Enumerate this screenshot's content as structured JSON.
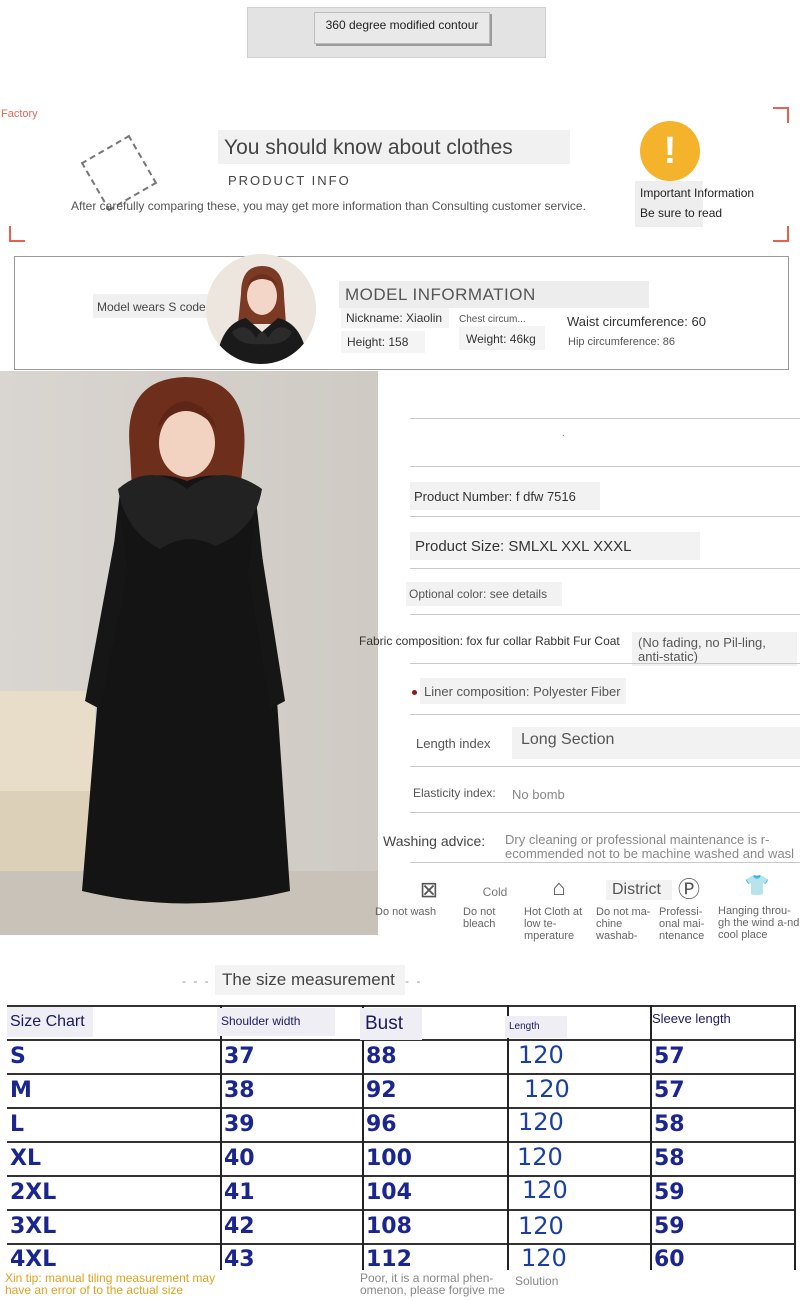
{
  "banner": {
    "button_label": "360 degree modified contour"
  },
  "know": {
    "factory": "Factory",
    "title": "You should know about clothes",
    "subtitle": "PRODUCT INFO",
    "note": "After carefully comparing these, you may get more information than Consulting customer service.",
    "important": "Important Information",
    "be_sure": "Be sure to read",
    "warn_symbol": "!"
  },
  "model": {
    "wears": "Model wears S code",
    "title": "MODEL INFORMATION",
    "nickname": "Nickname: Xiaolin",
    "chest": "Chest circum...",
    "waist": "Waist circumference: 60",
    "height": "Height: 158",
    "weight": "Weight: 46kg",
    "hip": "Hip circumference: 86"
  },
  "specs": {
    "dot": ".",
    "product_number": "Product Number: f dfw 7516",
    "product_size": "Product Size: SMLXL XXL XXXL",
    "optional_color": "Optional color: see details",
    "fabric": "Fabric composition: fox fur collar Rabbit Fur Coat",
    "fabric_note": "(No fading, no Pil-ling, anti-static)",
    "liner": "Liner composition: Polyester Fiber",
    "length_label": "Length index",
    "length_value": "Long Section",
    "elasticity_label": "Elasticity index:",
    "elasticity_value": "No bomb",
    "washing_label": "Washing advice:",
    "washing_value": "Dry cleaning or professional maintenance is r-ecommended not to be machine washed and wasl"
  },
  "care": [
    {
      "icon": "no-wash-icon",
      "glyph": "⊠",
      "text": "Do not wash"
    },
    {
      "icon": "no-bleach-icon",
      "glyph": "Cold",
      "text": "Do not bleach"
    },
    {
      "icon": "iron-icon",
      "glyph": "⌂",
      "text": "Hot Cloth at low te-mperature"
    },
    {
      "icon": "no-machine-wash-icon",
      "glyph": "District",
      "text": "Do not ma-chine washab-"
    },
    {
      "icon": "professional-care-icon",
      "glyph": "Ⓟ",
      "text": "Professi-onal mai-ntenance"
    },
    {
      "icon": "hang-dry-icon",
      "glyph": "👕",
      "text": "Hanging throu-gh the wind a-nd cool place"
    }
  ],
  "size_table": {
    "title": "The size measurement",
    "headers": [
      "Size Chart",
      "Shoulder width",
      "Bust",
      "Length",
      "Sleeve length"
    ],
    "rows": [
      [
        "S",
        "37",
        "88",
        "120",
        "57"
      ],
      [
        "M",
        "38",
        "92",
        "120",
        "57"
      ],
      [
        "L",
        "39",
        "96",
        "120",
        "58"
      ],
      [
        "XL",
        "40",
        "100",
        "120",
        "58"
      ],
      [
        "2XL",
        "41",
        "104",
        "120",
        "59"
      ],
      [
        "3XL",
        "42",
        "108",
        "120",
        "59"
      ],
      [
        "4XL",
        "43",
        "112",
        "120",
        "60"
      ]
    ],
    "tip": "Xin tip: manual tiling measurement may have an error of to the actual size",
    "poor": "Poor, it is a normal phen-omenon, please forgive me",
    "solution": "Solution"
  }
}
